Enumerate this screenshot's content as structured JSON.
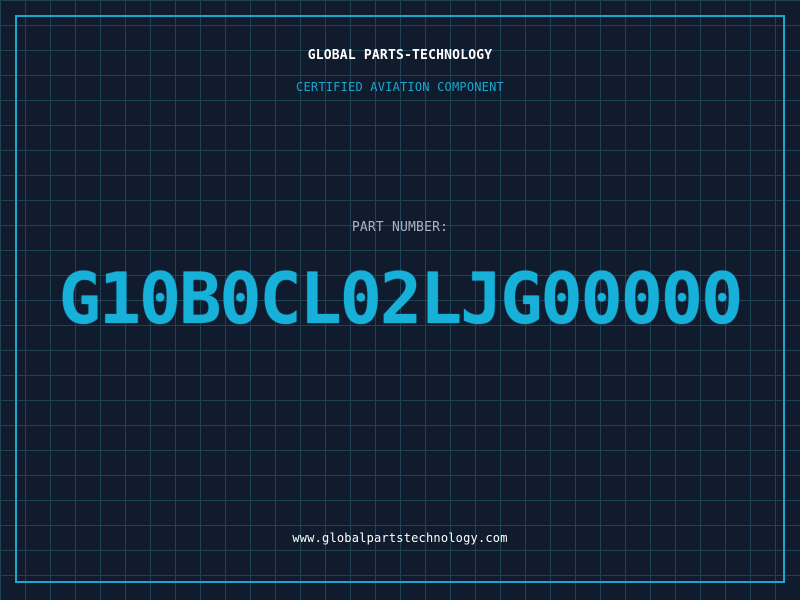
{
  "header": {
    "company": "GLOBAL PARTS-TECHNOLOGY",
    "tagline": "CERTIFIED AVIATION COMPONENT"
  },
  "part": {
    "label": "PART NUMBER:",
    "number": "G10B0CL02LJG00000"
  },
  "footer": {
    "website": "www.globalpartstechnology.com"
  },
  "colors": {
    "background": "#111b2e",
    "grid": "#1d4356",
    "accent": "#1aa7cf",
    "part_number": "#16b0d9",
    "label": "#a9b3c1",
    "heading": "#ffffff"
  }
}
